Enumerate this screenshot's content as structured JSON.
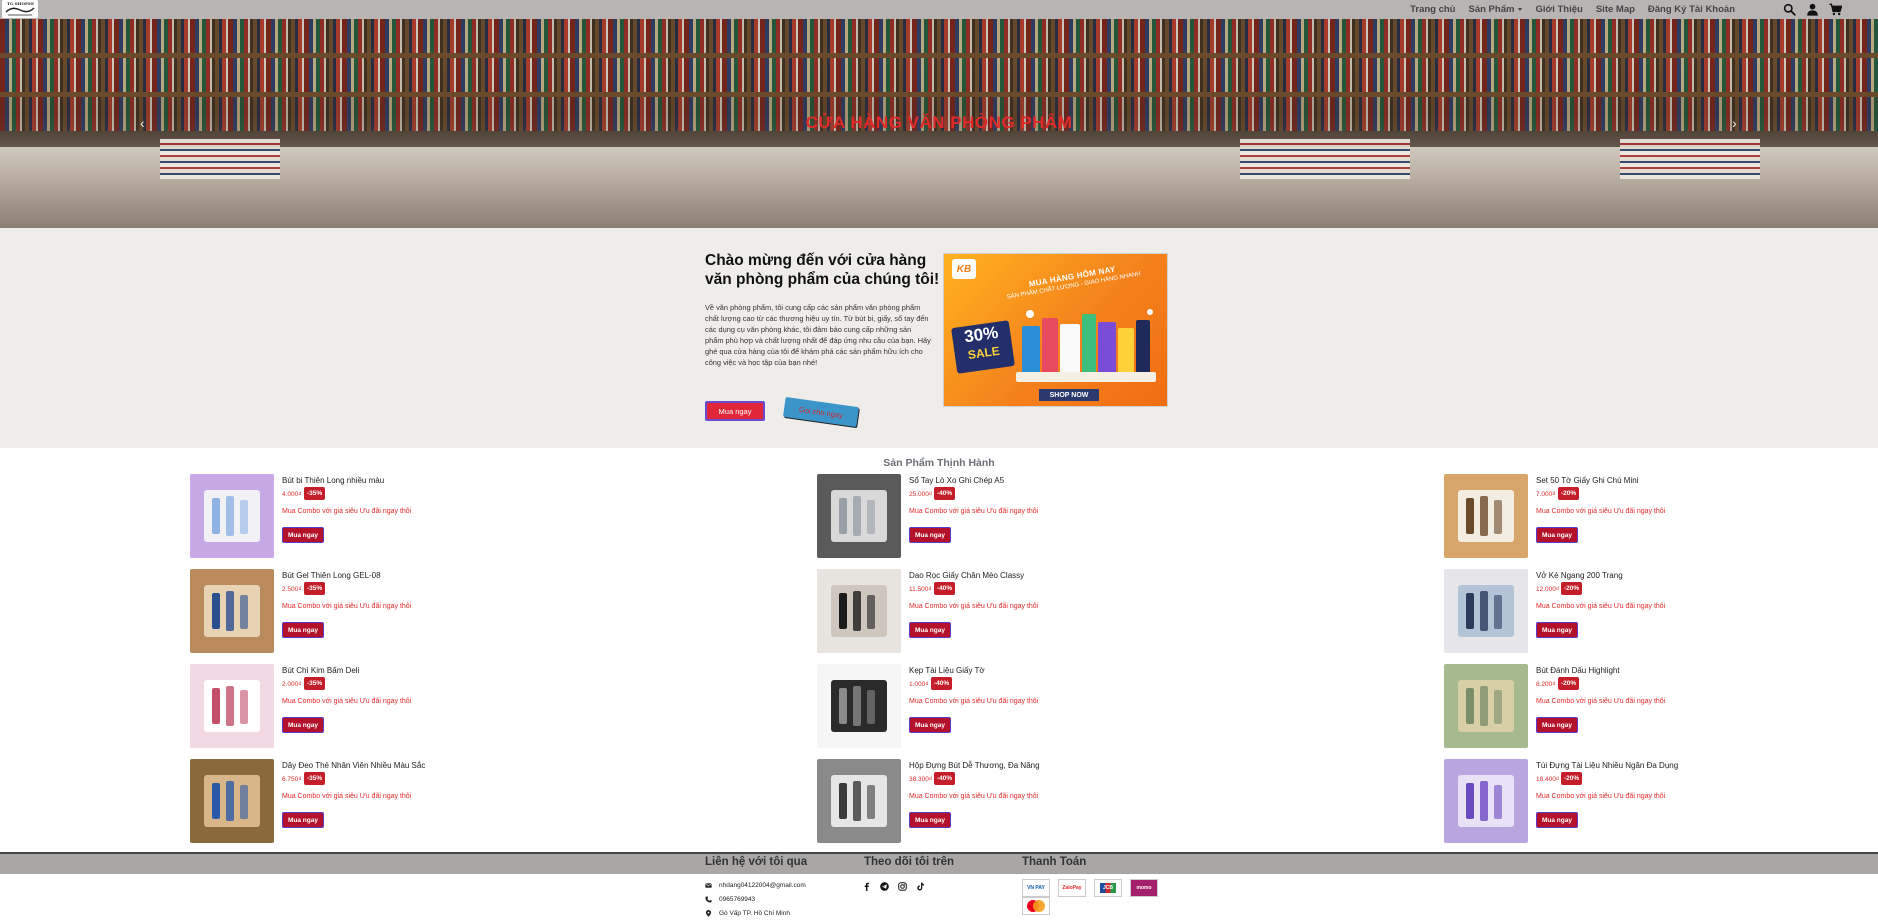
{
  "nav": {
    "logo_text": "TG SHOPEE",
    "links": [
      "Trang chủ",
      "Sản Phẩm",
      "Giới Thiệu",
      "Site Map",
      "Đăng Ký Tài Khoản"
    ],
    "icons": [
      "search-icon",
      "user-icon",
      "cart-icon"
    ]
  },
  "hero": {
    "title": "CỬA HÀNG VĂN PHÒNG PHẨM",
    "prev": "‹",
    "next": "›"
  },
  "welcome": {
    "heading": "Chào mừng đến với cửa hàng văn phòng phẩm của chúng tôi!",
    "description": "Về văn phòng phẩm, tôi cung cấp các sản phẩm văn phòng phẩm chất lượng cao từ các thương hiệu uy tín. Từ bút bi, giấy, sổ tay đến các dụng cụ văn phòng khác, tôi đảm bảo cung cấp những sản phẩm phù hợp và chất lượng nhất để đáp ứng nhu cầu của bạn. Hãy ghé qua cửa hàng của tôi để khám phá các sản phẩm hữu ích cho công việc và học tập của bạn nhé!",
    "buy_label": "Mua ngay",
    "second_label": "Gọi cho ngay",
    "promo": {
      "logo": "KB",
      "line1": "MUA HÀNG HÔM NAY",
      "line2": "SẢN PHẨM CHẤT LƯỢNG - GIAO HÀNG NHANH",
      "sale_pct": "30%",
      "sale_word": "SALE",
      "shop": "SHOP NOW"
    }
  },
  "products": {
    "title": "Sản Phẩm Thịnh Hành",
    "combo_text": "Mua Combo với giá siêu Ưu đãi ngay thôi",
    "button_label": "Mua ngay",
    "items": [
      {
        "name": "Bút bi Thiên Long nhiều màu",
        "price": "4.000₫",
        "discount": "-35%"
      },
      {
        "name": "Sổ Tay Lò Xo Ghi Chép A5",
        "price": "25.000₫",
        "discount": "-40%"
      },
      {
        "name": "Set 50 Tờ Giấy Ghi Chú Mini",
        "price": "7.000₫",
        "discount": "-20%"
      },
      {
        "name": "Bút Gel Thiên Long GEL-08",
        "price": "2.500₫",
        "discount": "-35%"
      },
      {
        "name": "Dao Rọc Giấy Chân Mèo Classy",
        "price": "11.500₫",
        "discount": "-40%"
      },
      {
        "name": "Vở Kẻ Ngang 200 Trang",
        "price": "12.000₫",
        "discount": "-20%"
      },
      {
        "name": "Bút Chì Kim Bấm Deli",
        "price": "2.000₫",
        "discount": "-35%"
      },
      {
        "name": "Kẹp Tài Liệu Giấy Tờ",
        "price": "1.000₫",
        "discount": "-40%"
      },
      {
        "name": "Bút Đánh Dấu Highlight",
        "price": "8.200₫",
        "discount": "-20%"
      },
      {
        "name": "Dây Đeo Thẻ Nhân Viên Nhiều Màu Sắc",
        "price": "6.750₫",
        "discount": "-35%"
      },
      {
        "name": "Hộp Đựng Bút Dễ Thương, Đa Năng",
        "price": "38.300₫",
        "discount": "-40%"
      },
      {
        "name": "Túi Đựng Tài Liệu Nhiều Ngăn Đa Dụng",
        "price": "18.400₫",
        "discount": "-20%"
      }
    ]
  },
  "footer": {
    "contact_title": "Liên hệ với tôi qua",
    "follow_title": "Theo dõi tôi trên",
    "payment_title": "Thanh Toán",
    "email": "nhdang04122004@gmail.com",
    "phone": "0965769943",
    "address": "Gò Vấp TP. Hồ Chí Minh",
    "social_icons": [
      "facebook-icon",
      "telegram-icon",
      "instagram-icon",
      "tiktok-icon"
    ],
    "payments": [
      "VN PAY",
      "ZaloPay",
      "JCB",
      "momo",
      "mastercard"
    ]
  },
  "colors": {
    "nav_bg": "#b8b4b4",
    "accent_red": "#e02a2a",
    "discount_bg": "#c41e2a",
    "button_bg": "#b3122a",
    "welcome_bg": "#efedea",
    "footer_bar": "#a9a6a6"
  }
}
